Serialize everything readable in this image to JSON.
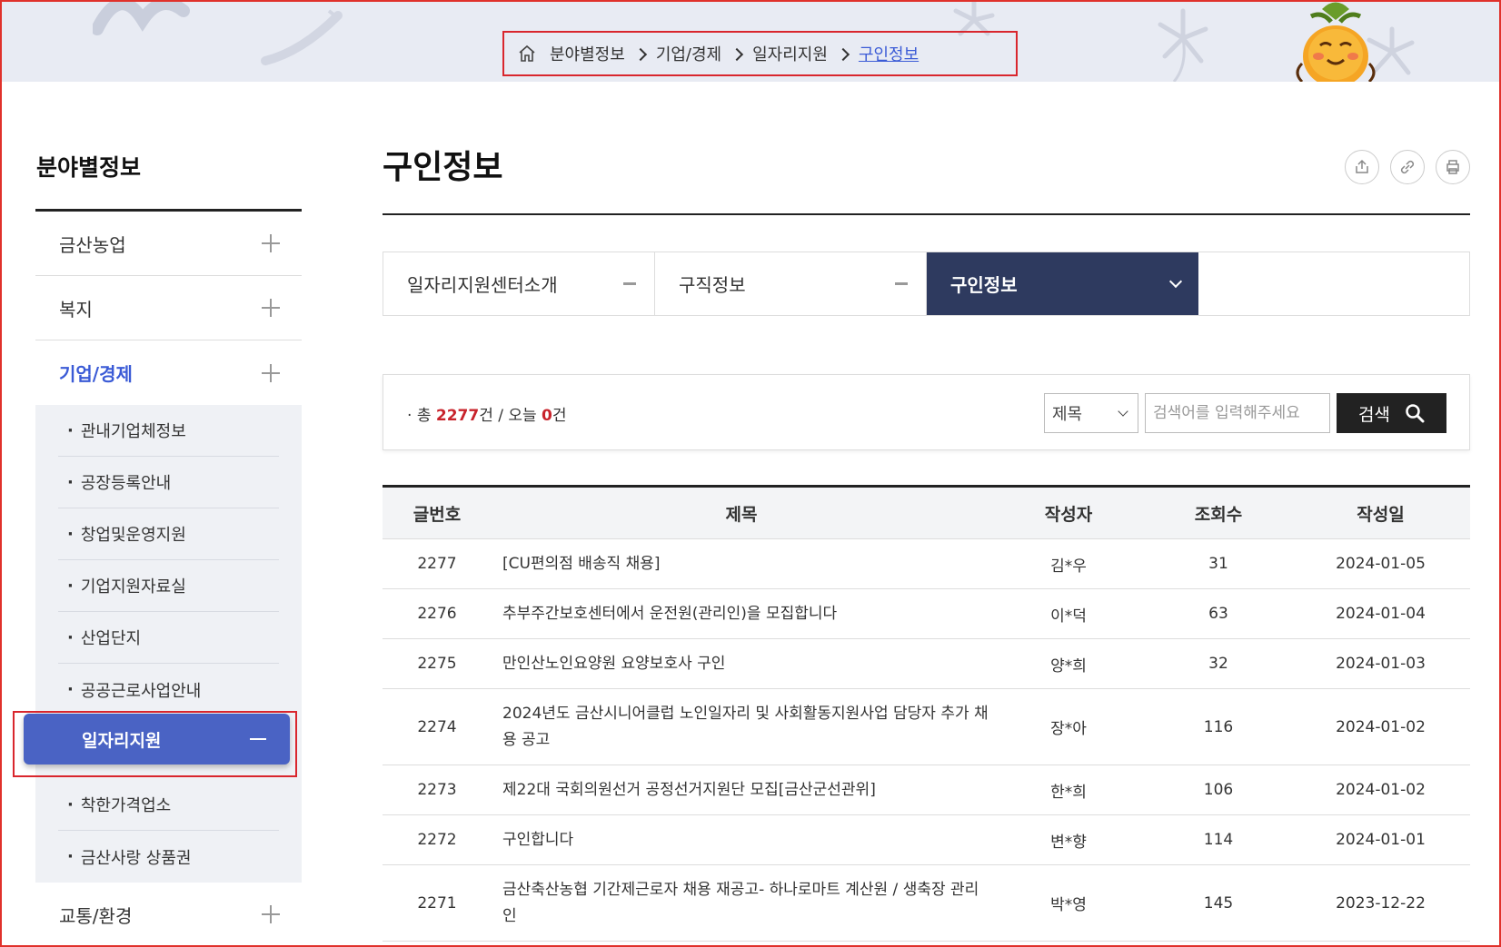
{
  "breadcrumb": {
    "items": [
      "분야별정보",
      "기업/경제",
      "일자리지원"
    ],
    "current": "구인정보"
  },
  "sidebar": {
    "title": "분야별정보",
    "top_items": [
      {
        "label": "금산농업"
      },
      {
        "label": "복지"
      },
      {
        "label": "기업/경제"
      }
    ],
    "sub_items": [
      "관내기업체정보",
      "공장등록안내",
      "창업및운영지원",
      "기업지원자료실",
      "산업단지",
      "공공근로사업안내"
    ],
    "active_sub": "일자리지원",
    "sub_items_after": [
      "착한가격업소",
      "금산사랑 상품권"
    ],
    "bottom_items": [
      {
        "label": "교통/환경"
      }
    ]
  },
  "page": {
    "title": "구인정보"
  },
  "tabs": [
    {
      "label": "일자리지원센터소개"
    },
    {
      "label": "구직정보"
    },
    {
      "label": "구인정보"
    }
  ],
  "search": {
    "total_prefix": "총 ",
    "total": "2277",
    "total_suffix": "건 / 오늘 ",
    "today": "0",
    "today_suffix": "건",
    "select_value": "제목",
    "placeholder": "검색어를 입력해주세요",
    "button_label": "검색"
  },
  "table": {
    "headers": [
      "글번호",
      "제목",
      "작성자",
      "조회수",
      "작성일"
    ],
    "rows": [
      {
        "no": "2277",
        "title": "[CU편의점 배송직 채용]",
        "author": "김*우",
        "views": "31",
        "date": "2024-01-05"
      },
      {
        "no": "2276",
        "title": "추부주간보호센터에서 운전원(관리인)을 모집합니다",
        "author": "이*덕",
        "views": "63",
        "date": "2024-01-04"
      },
      {
        "no": "2275",
        "title": "만인산노인요양원 요양보호사 구인",
        "author": "양*희",
        "views": "32",
        "date": "2024-01-03"
      },
      {
        "no": "2274",
        "title": "2024년도 금산시니어클럽 노인일자리 및 사회활동지원사업 담당자 추가 채용 공고",
        "author": "장*아",
        "views": "116",
        "date": "2024-01-02"
      },
      {
        "no": "2273",
        "title": "제22대 국회의원선거 공정선거지원단 모집[금산군선관위]",
        "author": "한*희",
        "views": "106",
        "date": "2024-01-02"
      },
      {
        "no": "2272",
        "title": "구인합니다",
        "author": "변*향",
        "views": "114",
        "date": "2024-01-01"
      },
      {
        "no": "2271",
        "title": "금산축산농협 기간제근로자 채용 재공고- 하나로마트 계산원 / 생축장 관리인",
        "author": "박*영",
        "views": "145",
        "date": "2023-12-22"
      }
    ]
  },
  "colors": {
    "accent": "#3b5bd6",
    "tab_active": "#2e3a5f",
    "sub_active": "#4a63c4",
    "highlight_border": "#d9262d",
    "count_red": "#c8232b"
  }
}
